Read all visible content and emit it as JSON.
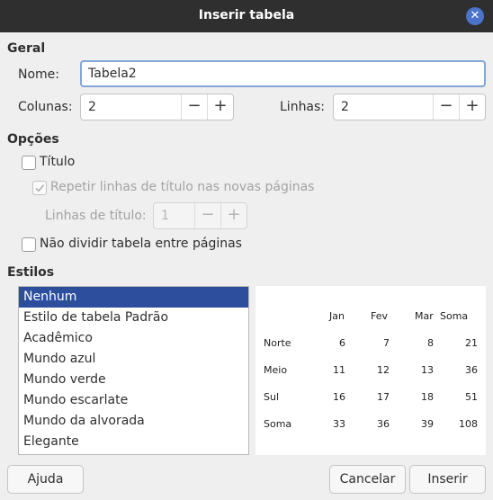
{
  "window": {
    "title": "Inserir tabela",
    "close_symbol": "✕"
  },
  "general": {
    "section_label": "Geral",
    "name_label": "Nome:",
    "name_value": "Tabela2",
    "columns_label": "Colunas:",
    "columns_value": "2",
    "rows_label": "Linhas:",
    "rows_value": "2"
  },
  "options": {
    "section_label": "Opções",
    "title_label": "Título",
    "title_checked": false,
    "repeat_label": "Repetir linhas de título nas novas páginas",
    "repeat_checked": true,
    "header_rows_label": "Linhas de título:",
    "header_rows_value": "1",
    "dont_split_label": "Não dividir tabela entre páginas",
    "dont_split_checked": false
  },
  "styles": {
    "section_label": "Estilos",
    "items": [
      "Nenhum",
      "Estilo de tabela Padrão",
      "Acadêmico",
      "Mundo azul",
      "Mundo verde",
      "Mundo escarlate",
      "Mundo da alvorada",
      "Elegante"
    ],
    "selected": "Nenhum"
  },
  "preview": {
    "columns": [
      "Jan",
      "Fev",
      "Mar",
      "Soma"
    ],
    "rows": [
      {
        "label": "Norte",
        "values": [
          "6",
          "7",
          "8",
          "21"
        ]
      },
      {
        "label": "Meio",
        "values": [
          "11",
          "12",
          "13",
          "36"
        ]
      },
      {
        "label": "Sul",
        "values": [
          "16",
          "17",
          "18",
          "51"
        ]
      },
      {
        "label": "Soma",
        "values": [
          "33",
          "36",
          "39",
          "108"
        ]
      }
    ]
  },
  "buttons": {
    "help": "Ajuda",
    "cancel": "Cancelar",
    "insert": "Inserir"
  },
  "spin_symbols": {
    "minus": "−",
    "plus": "+"
  }
}
